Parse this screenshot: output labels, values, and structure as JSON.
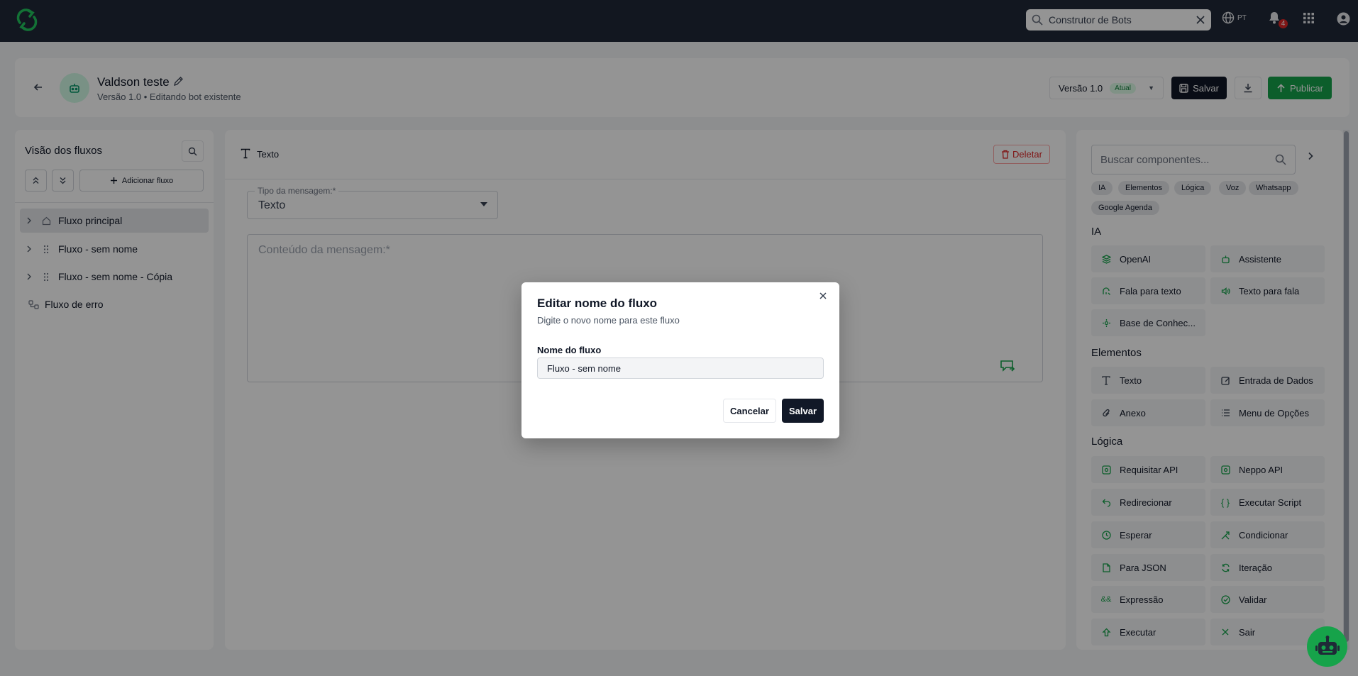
{
  "topbar": {
    "search_value": "Construtor de Bots",
    "language": "PT",
    "notification_count": "4"
  },
  "header": {
    "bot_name": "Valdson teste",
    "subtitle": "Versão 1.0 • Editando bot existente",
    "version_label": "Versão 1.0",
    "version_tag": "Atual",
    "save_label": "Salvar",
    "publish_label": "Publicar"
  },
  "left_panel": {
    "title": "Visão dos fluxos",
    "add_flow_label": "Adicionar fluxo",
    "flows": [
      {
        "label": "Fluxo principal",
        "icon": "home-icon",
        "active": true
      },
      {
        "label": "Fluxo - sem nome",
        "icon": "drag-handle-icon",
        "active": false
      },
      {
        "label": "Fluxo - sem nome - Cópia",
        "icon": "drag-handle-icon",
        "active": false
      }
    ],
    "error_flow_label": "Fluxo de erro"
  },
  "center_panel": {
    "node_type": "Texto",
    "delete_label": "Deletar",
    "message_type_label": "Tipo da mensagem:*",
    "message_type_value": "Texto",
    "message_content_placeholder": "Conteúdo da mensagem:*"
  },
  "right_panel": {
    "search_placeholder": "Buscar componentes...",
    "chips": [
      "IA",
      "Elementos",
      "Lógica",
      "Voz",
      "Whatsapp",
      "Google Agenda"
    ],
    "sections": [
      {
        "title": "IA",
        "items": [
          "OpenAI",
          "Assistente",
          "Fala para texto",
          "Texto para fala",
          "Base de Conhec..."
        ]
      },
      {
        "title": "Elementos",
        "items": [
          "Texto",
          "Entrada de Dados",
          "Anexo",
          "Menu de Opções"
        ]
      },
      {
        "title": "Lógica",
        "items": [
          "Requisitar API",
          "Neppo API",
          "Redirecionar",
          "Executar Script",
          "Esperar",
          "Condicionar",
          "Para JSON",
          "Iteração",
          "Expressão",
          "Validar",
          "Executar",
          "Sair"
        ]
      }
    ]
  },
  "modal": {
    "title": "Editar nome do fluxo",
    "description": "Digite o novo nome para este fluxo",
    "field_label": "Nome do fluxo",
    "field_value": "Fluxo - sem nome",
    "cancel_label": "Cancelar",
    "save_label": "Salvar"
  },
  "colors": {
    "topbar": "#1f2937",
    "accent_green": "#16a34a",
    "danger": "#dc2626",
    "primary_dark": "#111827"
  }
}
